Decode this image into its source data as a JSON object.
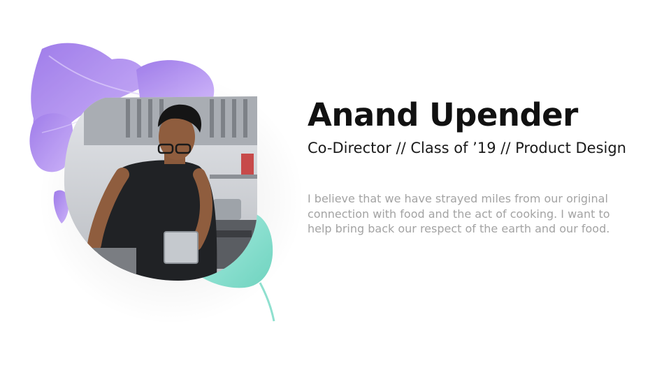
{
  "profile": {
    "name": "Anand Upender",
    "role": "Co-Director // Class of ’19 // Product Design",
    "bio": "I believe that we have strayed miles from our original connection with food and the act of cooking. I want to help bring back our respect of the earth and our food."
  },
  "colors": {
    "accent_leaf": "#a57cf0",
    "accent_radish": "#8fe0cf",
    "name_text": "#111111",
    "bio_text": "#a3a3a3"
  }
}
